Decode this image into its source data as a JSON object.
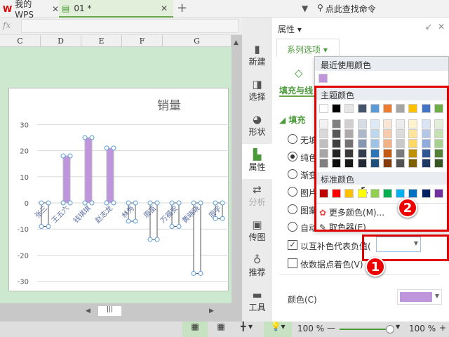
{
  "tabs": [
    {
      "label": "我的WPS",
      "icon": "wps-logo-icon"
    },
    {
      "label": "01 *",
      "icon": "sheet-doc-icon"
    }
  ],
  "search_placeholder": "点此查找命令",
  "formula_fx": "fx",
  "columns": [
    "C",
    "D",
    "E",
    "F",
    "G"
  ],
  "chart_data": {
    "type": "bar",
    "title": "销量",
    "categories": [
      "张三",
      "王五六",
      "钱琪琪",
      "赵志龙",
      "林秀",
      "周苗",
      "万福安",
      "黄晓晓",
      "周宇"
    ],
    "values": [
      -9,
      18,
      25,
      21,
      -7,
      -14,
      -9,
      -27,
      -6
    ],
    "ylim": [
      -30,
      30
    ],
    "yticks": [
      30,
      20,
      10,
      0,
      -10,
      -20,
      -30
    ],
    "grid": true,
    "positive_color": "#bf96dc",
    "negative_color": "#ffffff"
  },
  "sidebar": [
    {
      "label": "新建",
      "icon": "new-file-icon"
    },
    {
      "label": "选择",
      "icon": "select-icon"
    },
    {
      "label": "形状",
      "icon": "shape-icon"
    },
    {
      "label": "属性",
      "icon": "property-icon",
      "active": true
    },
    {
      "label": "分析",
      "icon": "analyze-icon",
      "disabled": true
    },
    {
      "label": "传图",
      "icon": "upload-image-icon"
    },
    {
      "label": "推荐",
      "icon": "recommend-icon"
    },
    {
      "label": "工具",
      "icon": "toolbox-icon"
    }
  ],
  "panel": {
    "title": "属性",
    "tab": "系列选项",
    "subtab": "填充与线",
    "section": "填充",
    "radios": [
      {
        "label": "无填",
        "checked": false
      },
      {
        "label": "纯色",
        "checked": true
      },
      {
        "label": "渐变",
        "checked": false
      },
      {
        "label": "图片",
        "checked": false
      },
      {
        "label": "图案",
        "checked": false
      },
      {
        "label": "自动",
        "checked": false
      }
    ],
    "invert_label": "以互补色代表负值(",
    "invert_checked": true,
    "vary_label": "依数据点着色(V)",
    "vary_checked": false,
    "color_label": "颜色(C)",
    "color_value": "#bf96dc"
  },
  "popup": {
    "recent_label": "最近使用颜色",
    "recent": [
      "#bf96dc"
    ],
    "theme_label": "主题颜色",
    "theme_top": [
      "#ffffff",
      "#000000",
      "#e7e6e6",
      "#44546a",
      "#5b9bd5",
      "#ed7d31",
      "#a5a5a5",
      "#ffc000",
      "#4472c4",
      "#70ad47"
    ],
    "theme_shades": [
      [
        "#f2f2f2",
        "#d9d9d9",
        "#bfbfbf",
        "#a6a6a6",
        "#808080"
      ],
      [
        "#808080",
        "#595959",
        "#404040",
        "#262626",
        "#0d0d0d"
      ],
      [
        "#d0cece",
        "#aeaaaa",
        "#757171",
        "#3a3838",
        "#171616"
      ],
      [
        "#d6dce4",
        "#adb9ca",
        "#8496b0",
        "#333f4f",
        "#222a35"
      ],
      [
        "#deebf6",
        "#bdd7ee",
        "#9dc3e6",
        "#2e75b5",
        "#1f4e79"
      ],
      [
        "#fbe5d5",
        "#f7cbac",
        "#f4b183",
        "#c55a11",
        "#843c0b"
      ],
      [
        "#ededed",
        "#dbdbdb",
        "#c9c9c9",
        "#7b7b7b",
        "#525252"
      ],
      [
        "#fff2cc",
        "#fee599",
        "#ffd965",
        "#bf9000",
        "#7f6000"
      ],
      [
        "#dae3f3",
        "#b4c7e7",
        "#8faadc",
        "#2f5597",
        "#203864"
      ],
      [
        "#e2efd9",
        "#c5e0b3",
        "#a8d08d",
        "#538135",
        "#375623"
      ]
    ],
    "standard_label": "标准颜色",
    "standard": [
      "#c00000",
      "#ff0000",
      "#ffc000",
      "#ffff00",
      "#92d050",
      "#00b050",
      "#00b0f0",
      "#0070c0",
      "#002060",
      "#7030a0"
    ],
    "more_colors": "更多颜色(M)...",
    "picker": "取色器(E)"
  },
  "annotations": [
    "1",
    "2"
  ],
  "status": {
    "zoom1": "100 %",
    "zoom2": "100 %",
    "zoom_level": 0.95
  }
}
